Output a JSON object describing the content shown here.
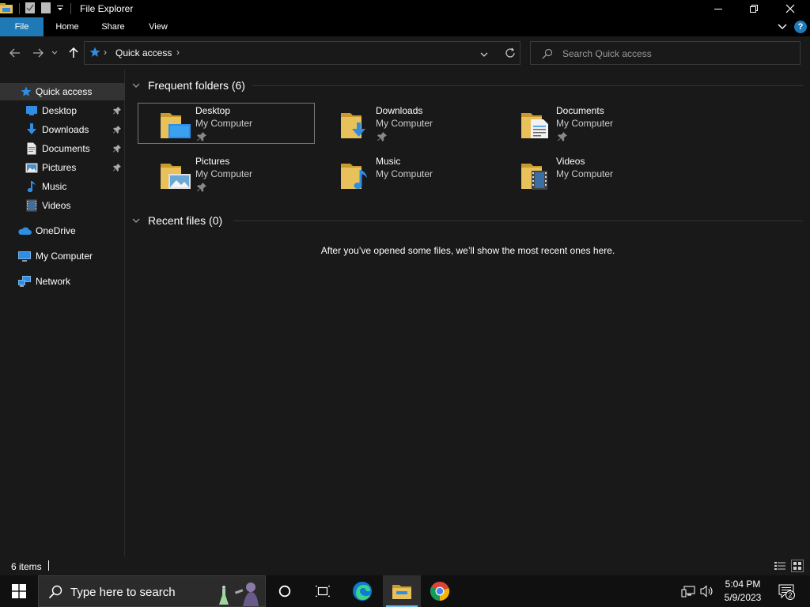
{
  "window": {
    "title": "File Explorer",
    "minimize_glyph": "—",
    "restore_glyph": "❐",
    "close_glyph": "✕"
  },
  "ribbon": {
    "tabs": [
      {
        "label": "File",
        "active": true
      },
      {
        "label": "Home"
      },
      {
        "label": "Share"
      },
      {
        "label": "View"
      }
    ],
    "help_glyph": "?"
  },
  "address": {
    "path_root_icon": "quick-access-star-icon",
    "crumb": "Quick access",
    "separator": "›"
  },
  "search": {
    "placeholder": "Search Quick access"
  },
  "nav": {
    "items": [
      {
        "label": "Quick access",
        "icon": "star-icon",
        "selected": true
      },
      {
        "label": "Desktop",
        "icon": "desktop-icon",
        "pinned": true
      },
      {
        "label": "Downloads",
        "icon": "download-arrow-icon",
        "pinned": true
      },
      {
        "label": "Documents",
        "icon": "document-icon",
        "pinned": true
      },
      {
        "label": "Pictures",
        "icon": "picture-icon",
        "pinned": true
      },
      {
        "label": "Music",
        "icon": "music-note-icon"
      },
      {
        "label": "Videos",
        "icon": "video-icon"
      },
      {
        "label": "OneDrive",
        "icon": "cloud-icon"
      },
      {
        "label": "My Computer",
        "icon": "computer-icon"
      },
      {
        "label": "Network",
        "icon": "network-icon"
      }
    ]
  },
  "frequent": {
    "header": "Frequent folders (6)",
    "folders": [
      {
        "name": "Desktop",
        "location": "My Computer",
        "pinned": true,
        "overlay": "desktop"
      },
      {
        "name": "Downloads",
        "location": "My Computer",
        "pinned": true,
        "overlay": "downloads"
      },
      {
        "name": "Documents",
        "location": "My Computer",
        "pinned": true,
        "overlay": "documents"
      },
      {
        "name": "Pictures",
        "location": "My Computer",
        "pinned": true,
        "overlay": "pictures"
      },
      {
        "name": "Music",
        "location": "My Computer",
        "pinned": false,
        "overlay": "music"
      },
      {
        "name": "Videos",
        "location": "My Computer",
        "pinned": false,
        "overlay": "videos"
      }
    ]
  },
  "recent": {
    "header": "Recent files (0)",
    "empty_message": "After you’ve opened some files, we’ll show the most recent ones here."
  },
  "status": {
    "items_text": "6 items"
  },
  "taskbar": {
    "search_text": "Type here to search",
    "time": "5:04 PM",
    "date": "5/9/2023",
    "notification_count": "2"
  },
  "colors": {
    "accent": "#1f79b5",
    "folder_yellow": "#e8c15a",
    "folder_dark": "#c99a2e",
    "blue_icon": "#2f8de4"
  }
}
